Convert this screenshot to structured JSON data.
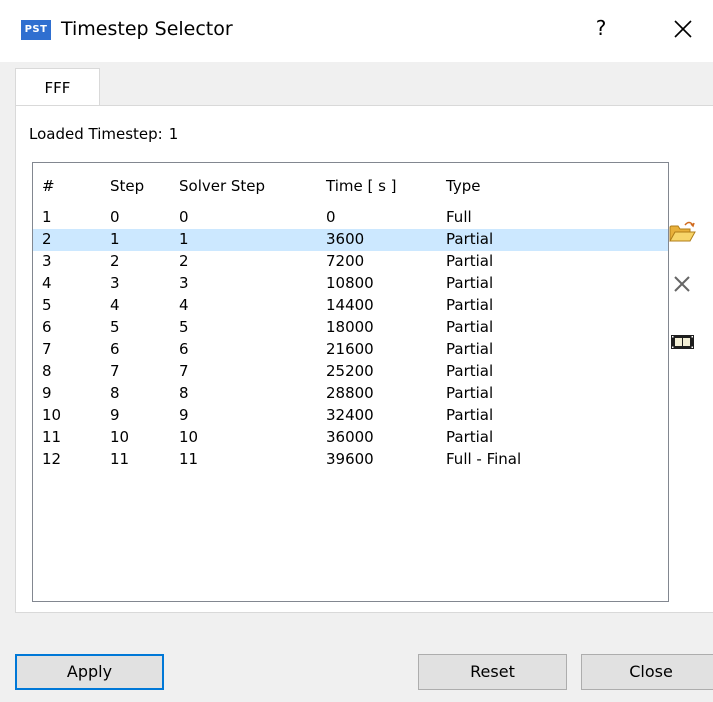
{
  "window": {
    "app_icon_text": "PST",
    "title": "Timestep Selector",
    "help": "?"
  },
  "tab": {
    "label": "FFF"
  },
  "loaded": {
    "label": "Loaded Timestep:",
    "value": "1"
  },
  "table": {
    "columns": [
      "#",
      "Step",
      "Solver Step",
      "Time [ s ]",
      "Type"
    ],
    "rows": [
      [
        "1",
        "0",
        "0",
        "0",
        "Full"
      ],
      [
        "2",
        "1",
        "1",
        "3600",
        "Partial"
      ],
      [
        "3",
        "2",
        "2",
        "7200",
        "Partial"
      ],
      [
        "4",
        "3",
        "3",
        "10800",
        "Partial"
      ],
      [
        "5",
        "4",
        "4",
        "14400",
        "Partial"
      ],
      [
        "6",
        "5",
        "5",
        "18000",
        "Partial"
      ],
      [
        "7",
        "6",
        "6",
        "21600",
        "Partial"
      ],
      [
        "8",
        "7",
        "7",
        "25200",
        "Partial"
      ],
      [
        "9",
        "8",
        "8",
        "28800",
        "Partial"
      ],
      [
        "10",
        "9",
        "9",
        "32400",
        "Partial"
      ],
      [
        "11",
        "10",
        "10",
        "36000",
        "Partial"
      ],
      [
        "12",
        "11",
        "11",
        "39600",
        "Full - Final"
      ]
    ],
    "selected_row": 1
  },
  "tools": [
    "open-folder-icon",
    "delete-icon",
    "film-icon"
  ],
  "buttons": {
    "apply": "Apply",
    "reset": "Reset",
    "close": "Close"
  },
  "colors": {
    "selection": "#cce8ff",
    "accent": "#0078d7",
    "folder": "#f2c744"
  }
}
